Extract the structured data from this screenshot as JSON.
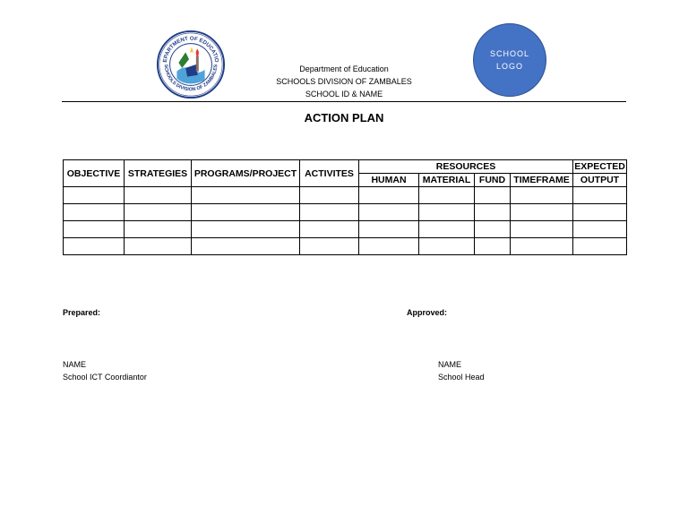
{
  "header": {
    "department": "Department of Education",
    "division": "SCHOOLS DIVISION OF ZAMBALES",
    "school": "SCHOOL ID & NAME"
  },
  "seal": {
    "top_text": "DEPARTMENT OF EDUCATION",
    "bottom_text": "SCHOOLS DIVISION OF ZAMBALES"
  },
  "school_logo": {
    "line1": "SCHOOL",
    "line2": "LOGO"
  },
  "title": "ACTION PLAN",
  "table": {
    "headers": {
      "objective": "OBJECTIVE",
      "strategies": "STRATEGIES",
      "programs": "PROGRAMS/PROJECT",
      "activites": "ACTIVITES",
      "resources": "RESOURCES",
      "human": "HUMAN",
      "material": "MATERIAL",
      "fund": "FUND",
      "timeframe": "TIMEFRAME",
      "expected_line1": "EXPECTED",
      "expected_line2": "OUTPUT"
    },
    "empty_rows": 4
  },
  "signatures": {
    "prepared_label": "Prepared:",
    "approved_label": "Approved:",
    "prepared_name": "NAME",
    "prepared_role": "School ICT Coordiantor",
    "approved_name": "NAME",
    "approved_role": "School Head"
  },
  "colors": {
    "logo_fill": "#4472c4",
    "seal_blue": "#1f3c88"
  }
}
